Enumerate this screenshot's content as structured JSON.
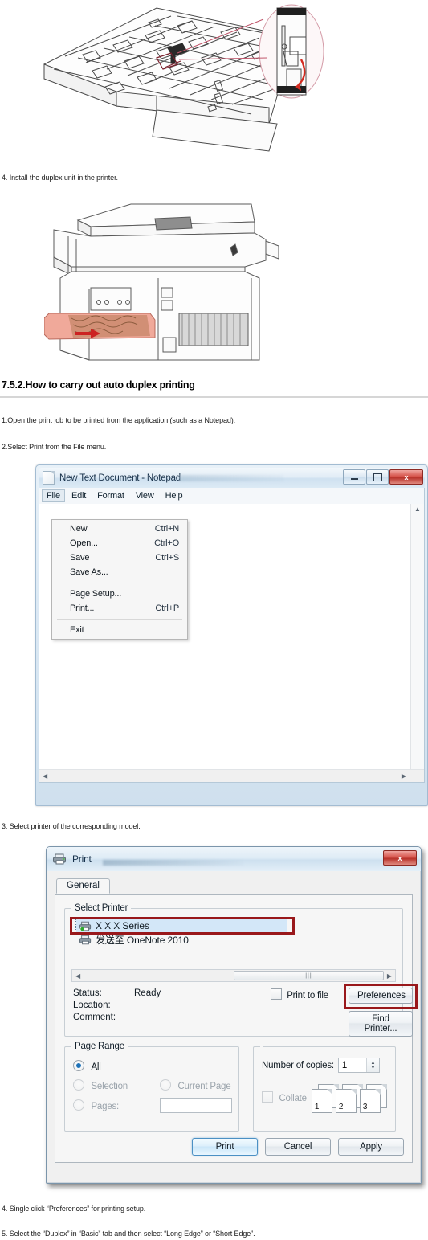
{
  "document": {
    "step4_install": "4. Install the duplex unit in the printer.",
    "section_heading": "7.5.2.How to carry out auto duplex printing",
    "step1": "1.Open the print job to be printed from the application (such as a Notepad).",
    "step2": "2.Select Print from the File menu.",
    "step3": "3. Select printer of the corresponding model.",
    "step4_prefs": "4. Single click “Preferences” for printing setup.",
    "step5_duplex": "5. Select the “Duplex” in “Basic” tab and then select “Long Edge” or “Short Edge”."
  },
  "illustrations": {
    "duplex_tray": {
      "name": "duplex-unit-tray-diagram",
      "callout_color": "#c0566b",
      "arrow_color": "#d42b20"
    },
    "printer_rear": {
      "name": "printer-rear-duplex-insert-diagram",
      "highlight_color": "#f0a99a",
      "arrow_color": "#cc2222"
    }
  },
  "notepad": {
    "title": "New Text Document - Notepad",
    "doc_icon": "document-icon",
    "window_buttons": {
      "minimize": "minimize-icon",
      "maximize": "maximize-icon",
      "close": "x"
    },
    "menus": [
      "File",
      "Edit",
      "Format",
      "View",
      "Help"
    ],
    "active_menu": "File",
    "file_menu": [
      {
        "label": "New",
        "accel": "Ctrl+N",
        "sep_after": false
      },
      {
        "label": "Open...",
        "accel": "Ctrl+O",
        "sep_after": false
      },
      {
        "label": "Save",
        "accel": "Ctrl+S",
        "sep_after": false
      },
      {
        "label": "Save As...",
        "accel": "",
        "sep_after": true
      },
      {
        "label": "Page Setup...",
        "accel": "",
        "sep_after": false
      },
      {
        "label": "Print...",
        "accel": "Ctrl+P",
        "sep_after": true
      },
      {
        "label": "Exit",
        "accel": "",
        "sep_after": false
      }
    ]
  },
  "print_dialog": {
    "title": "Print",
    "titlebar_icon": "printer-icon",
    "close_label": "x",
    "tabs": [
      "General"
    ],
    "active_tab": "General",
    "select_printer": {
      "legend": "Select Printer",
      "printers": [
        {
          "name": "X X X Series",
          "selected": true,
          "icon": "printer-ready-icon"
        },
        {
          "name": "发送至 OneNote 2010",
          "selected": false,
          "icon": "printer-icon"
        }
      ],
      "highlight_color": "#99181b"
    },
    "status": {
      "status_label": "Status:",
      "status_value": "Ready",
      "location_label": "Location:",
      "location_value": "",
      "comment_label": "Comment:",
      "comment_value": ""
    },
    "print_to_file": {
      "label": "Print to file",
      "checked": false
    },
    "preferences_button": "Preferences",
    "find_printer_button": "Find Printer...",
    "page_range": {
      "legend": "Page Range",
      "options": [
        {
          "label": "All",
          "selected": true,
          "enabled": true
        },
        {
          "label": "Selection",
          "selected": false,
          "enabled": false
        },
        {
          "label": "Current Page",
          "selected": false,
          "enabled": false
        },
        {
          "label": "Pages:",
          "selected": false,
          "enabled": false
        }
      ],
      "pages_value": ""
    },
    "copies": {
      "label": "Number of copies:",
      "value": "1",
      "collate_label": "Collate",
      "collate_checked": false,
      "collate_page_numbers": [
        "1",
        "2",
        "3"
      ]
    },
    "footer_buttons": [
      {
        "label": "Print",
        "primary": true
      },
      {
        "label": "Cancel",
        "primary": false
      },
      {
        "label": "Apply",
        "primary": false
      }
    ]
  }
}
